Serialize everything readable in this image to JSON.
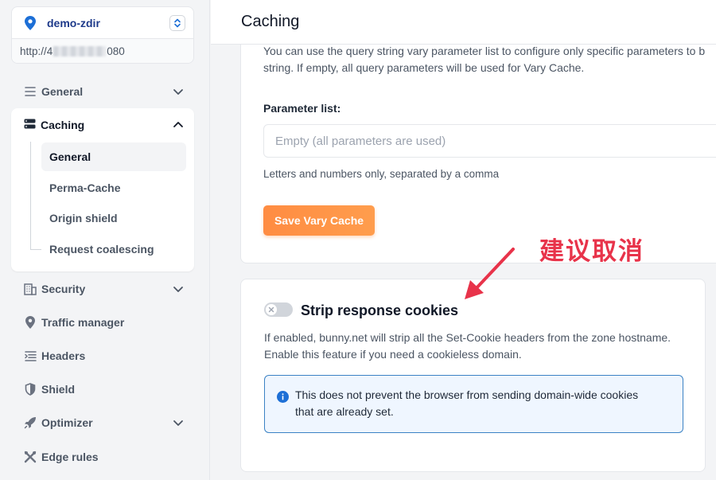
{
  "sidebar": {
    "zone": {
      "name": "demo-zdir",
      "url_prefix": "http://4",
      "url_suffix": "080"
    },
    "items": {
      "general": "General",
      "caching": "Caching",
      "security": "Security",
      "traffic_manager": "Traffic manager",
      "headers": "Headers",
      "shield": "Shield",
      "optimizer": "Optimizer",
      "edge_rules": "Edge rules"
    },
    "caching_sub": [
      "General",
      "Perma-Cache",
      "Origin shield",
      "Request coalescing"
    ]
  },
  "header": {
    "title": "Caching"
  },
  "vary_cache": {
    "description": "You can use the query string vary parameter list to configure only specific parameters to b string. If empty, all query parameters will be used for Vary Cache.",
    "desc_line1": "You can use the query string vary parameter list to configure only specific parameters to b",
    "desc_line2": "string. If empty, all query parameters will be used for Vary Cache.",
    "param_label": "Parameter list:",
    "param_value": "",
    "param_placeholder": "Empty (all parameters are used)",
    "param_help": "Letters and numbers only, separated by a comma",
    "save_label": "Save Vary Cache"
  },
  "strip_cookies": {
    "enabled": false,
    "title": "Strip response cookies",
    "desc_line1": "If enabled, bunny.net will strip all the Set-Cookie headers from the zone hostname.",
    "desc_line2": "Enable this feature if you need a cookieless domain.",
    "info_line1": "This does not prevent the browser from sending domain-wide cookies",
    "info_line2": "that are already set."
  },
  "annotation": {
    "text": "建议取消"
  },
  "colors": {
    "accent": "#ff8c42",
    "brand": "#1e3a8a",
    "annotation": "#e8334a",
    "info": "#3b82c4"
  }
}
